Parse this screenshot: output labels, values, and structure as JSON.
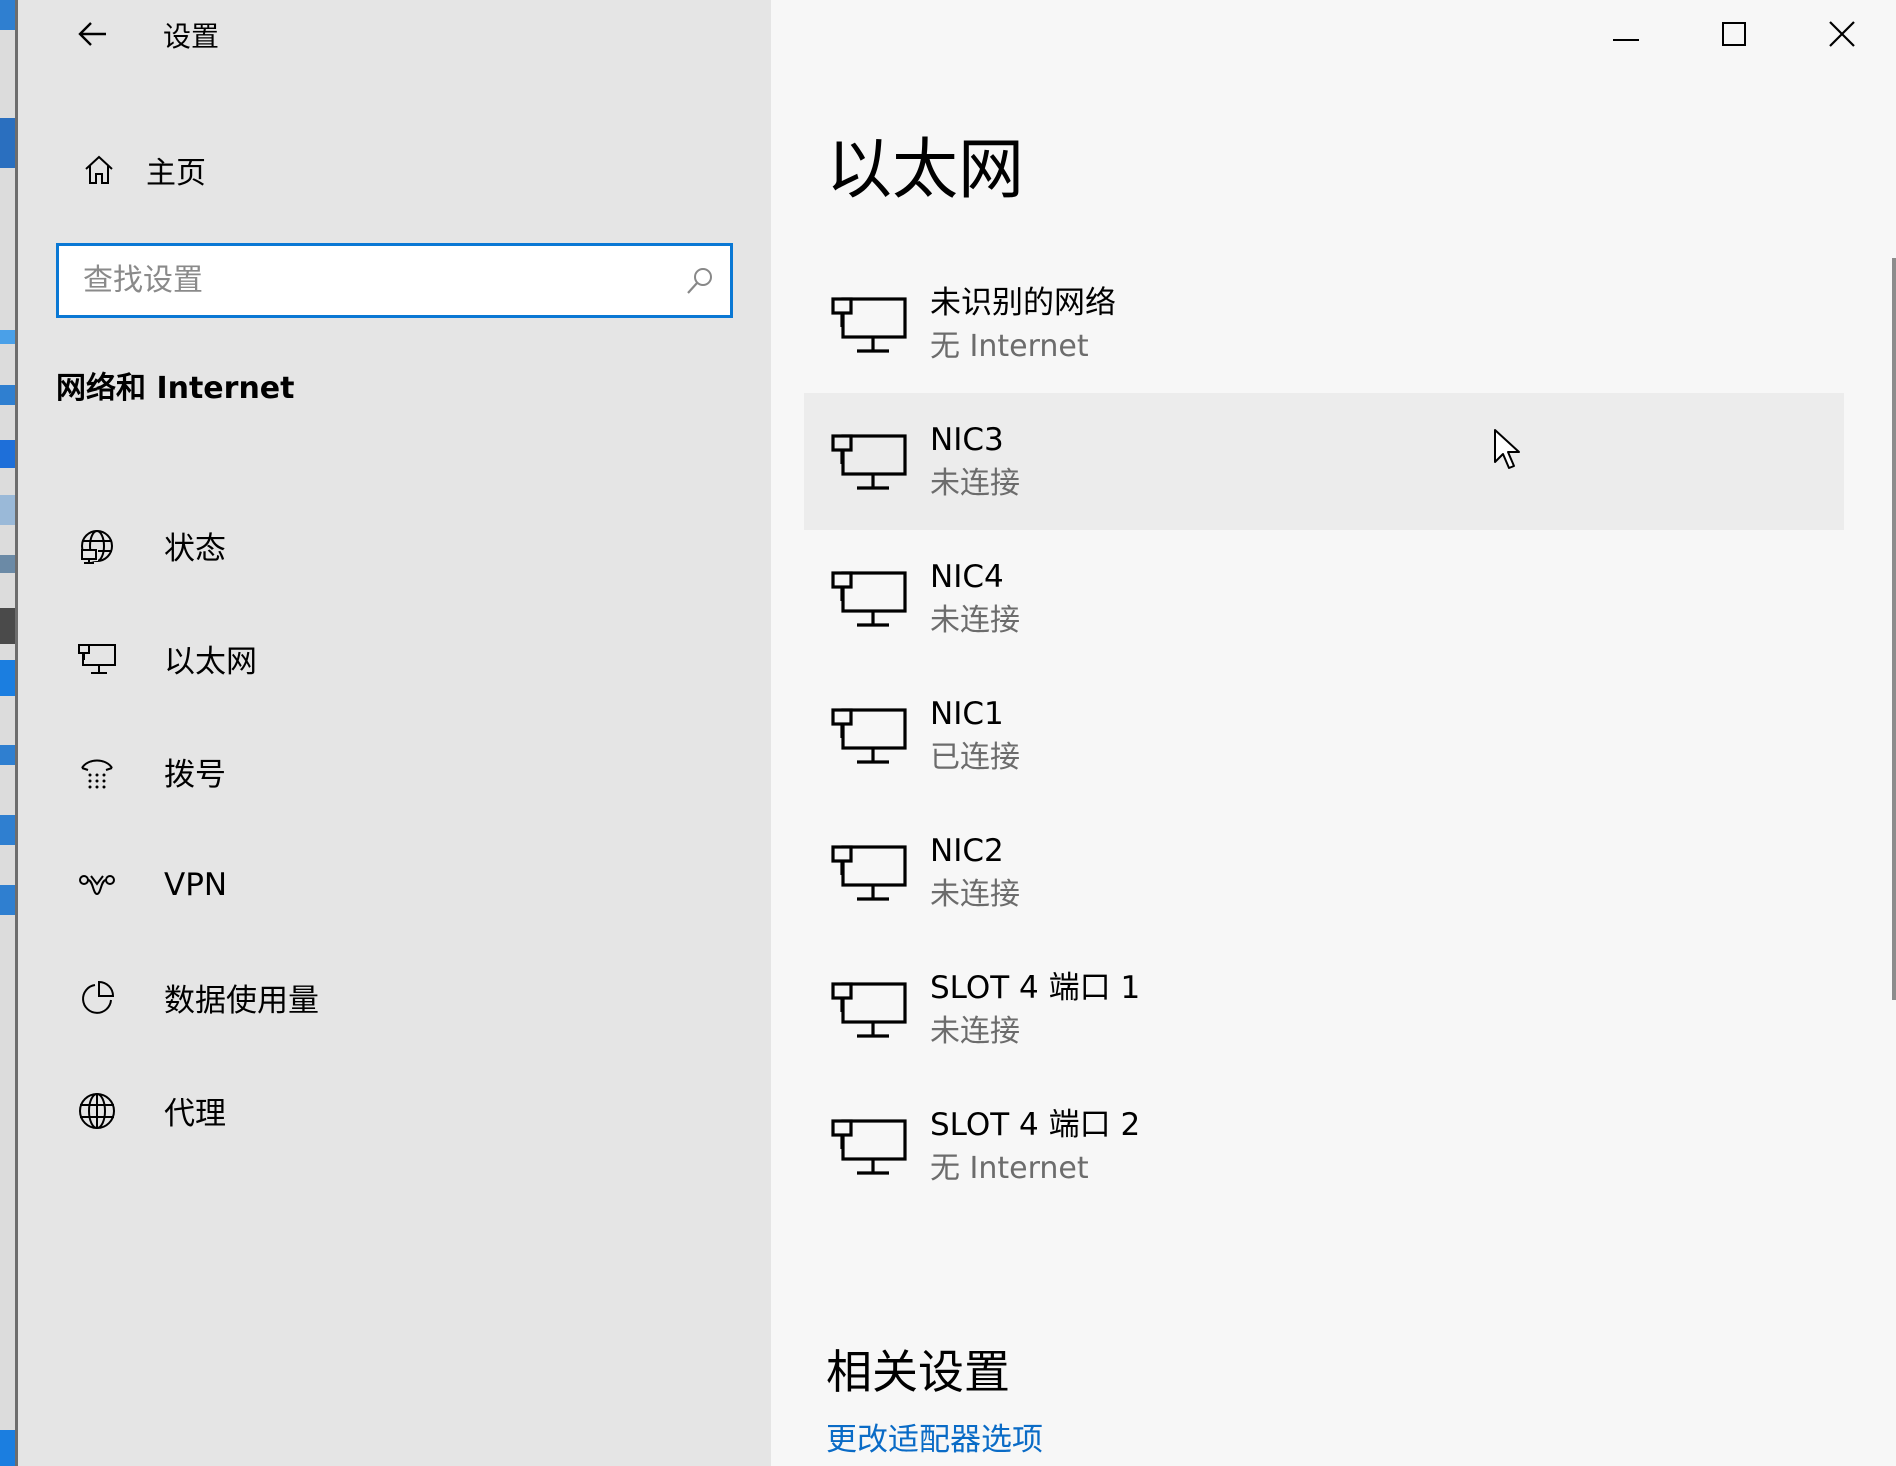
{
  "window": {
    "title": "设置",
    "controls": {
      "minimize": "minimize-icon",
      "maximize": "maximize-icon",
      "close": "close-icon"
    }
  },
  "sidebar": {
    "home_label": "主页",
    "search": {
      "placeholder": "查找设置",
      "value": ""
    },
    "section_title": "网络和 Internet",
    "items": [
      {
        "label": "状态",
        "icon": "globe-status-icon",
        "active": false
      },
      {
        "label": "以太网",
        "icon": "ethernet-icon",
        "active": true
      },
      {
        "label": "拨号",
        "icon": "dialup-icon",
        "active": false
      },
      {
        "label": "VPN",
        "icon": "vpn-icon",
        "active": false
      },
      {
        "label": "数据使用量",
        "icon": "data-usage-icon",
        "active": false
      },
      {
        "label": "代理",
        "icon": "globe-icon",
        "active": false
      }
    ]
  },
  "main": {
    "title": "以太网",
    "networks": [
      {
        "name": "未识别的网络",
        "status": "无 Internet"
      },
      {
        "name": "NIC3",
        "status": "未连接"
      },
      {
        "name": "NIC4",
        "status": "未连接"
      },
      {
        "name": "NIC1",
        "status": "已连接"
      },
      {
        "name": "NIC2",
        "status": "未连接"
      },
      {
        "name": "SLOT 4 端口 1",
        "status": "未连接"
      },
      {
        "name": "SLOT 4 端口 2",
        "status": "无 Internet"
      }
    ],
    "related_title": "相关设置",
    "related_link": "更改适配器选项"
  },
  "colors": {
    "accent": "#0a78d4",
    "link": "#0a6bc6",
    "sidebar_bg": "#e5e5e5",
    "main_bg": "#f7f7f7",
    "hover_row": "#ececec"
  }
}
